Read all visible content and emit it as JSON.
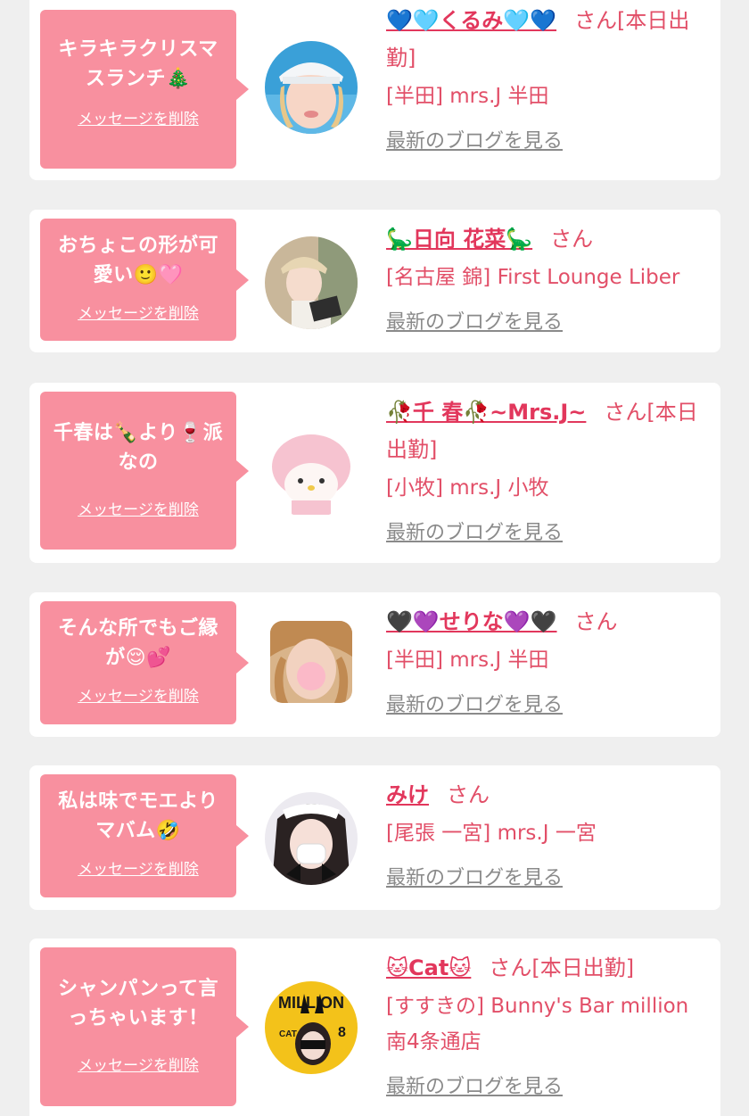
{
  "colors": {
    "background": "#efefef",
    "card": "#ffffff",
    "bubble": "#f8909f",
    "accent_text": "#e24f68",
    "link_gray": "#8a8a8a"
  },
  "messages": [
    {
      "message": "キラキラクリスマスランチ🎄",
      "delete_label": "メッセージを削除",
      "name": "💙🩵くるみ🩵💙",
      "san": "さん[本日出勤]",
      "store": "[半田] mrs.J 半田",
      "blog_label": "最新のブログを見る",
      "avatar_icon": "avatar-woman-white-cap"
    },
    {
      "message": "おちょこの形が可愛い🙂🩷",
      "delete_label": "メッセージを削除",
      "name": "🦕日向 花菜🦕",
      "san": "さん",
      "store": "[名古屋 錦] First Lounge Liber",
      "blog_label": "最新のブログを見る",
      "avatar_icon": "avatar-woman-beige-cap"
    },
    {
      "message": "千春は🍾より🍷派なの",
      "delete_label": "メッセージを削除",
      "name": "🥀千 春🥀~Mrs.J~",
      "san": "さん[本日出勤]",
      "store": "[小牧] mrs.J 小牧",
      "blog_label": "最新のブログを見る",
      "avatar_icon": "avatar-plush-toy"
    },
    {
      "message": "そんな所でもご縁が😌💕",
      "delete_label": "メッセージを削除",
      "name": "🖤💜せりな💜🖤",
      "san": "さん",
      "store": "[半田] mrs.J 半田",
      "blog_label": "最新のブログを見る",
      "avatar_icon": "avatar-woman-blonde"
    },
    {
      "message": "私は味でモエよりマバム🤣",
      "delete_label": "メッセージを削除",
      "name": "みけ",
      "san": "さん",
      "store": "[尾張 一宮] mrs.J 一宮",
      "blog_label": "最新のブログを見る",
      "avatar_icon": "avatar-woman-maid"
    },
    {
      "message": "シャンパンって言っちゃいます！",
      "delete_label": "メッセージを削除",
      "name": "🐱Cat🐱",
      "san": "さん[本日出勤]",
      "store": "[すすきの] Bunny's Bar million 南4条通店",
      "blog_label": "最新のブログを見る",
      "avatar_icon": "avatar-magazine-cover",
      "avatar_text_1": "MILLION",
      "avatar_text_2": "CAT",
      "avatar_text_3": "8"
    }
  ]
}
